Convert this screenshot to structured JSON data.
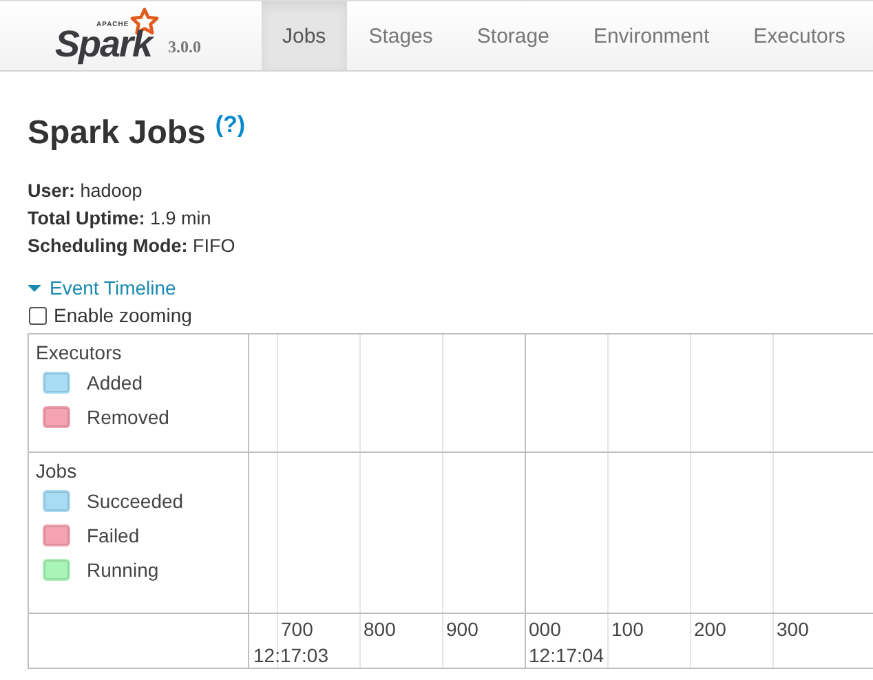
{
  "navbar": {
    "logo": {
      "small": "APACHE",
      "name": "Spark"
    },
    "version": "3.0.0",
    "tabs": [
      {
        "label": "Jobs",
        "selected": true
      },
      {
        "label": "Stages",
        "selected": false
      },
      {
        "label": "Storage",
        "selected": false
      },
      {
        "label": "Environment",
        "selected": false
      },
      {
        "label": "Executors",
        "selected": false
      }
    ]
  },
  "heading": {
    "title": "Spark Jobs",
    "help": "(?)"
  },
  "summary": [
    {
      "label": "User:",
      "value": "hadoop"
    },
    {
      "label": "Total Uptime:",
      "value": "1.9 min"
    },
    {
      "label": "Scheduling Mode:",
      "value": "FIFO"
    }
  ],
  "timeline": {
    "toggle": {
      "label": "Event Timeline",
      "expanded": true
    },
    "zoom": {
      "label": "Enable zooming",
      "checked": false
    },
    "groups": [
      {
        "title": "Executors",
        "items": [
          {
            "label": "Added",
            "color": "#a8dcf5"
          },
          {
            "label": "Removed",
            "color": "#f5a3b1"
          }
        ]
      },
      {
        "title": "Jobs",
        "items": [
          {
            "label": "Succeeded",
            "color": "#a8dcf5"
          },
          {
            "label": "Failed",
            "color": "#f5a3b1"
          },
          {
            "label": "Running",
            "color": "#a9f5b8"
          }
        ]
      }
    ],
    "axis": {
      "segments": [
        {
          "time": "12:17:03",
          "ticks": [
            "700",
            "800",
            "900"
          ]
        },
        {
          "time": "12:17:04",
          "ticks": [
            "000",
            "100",
            "200",
            "300"
          ]
        }
      ]
    }
  }
}
